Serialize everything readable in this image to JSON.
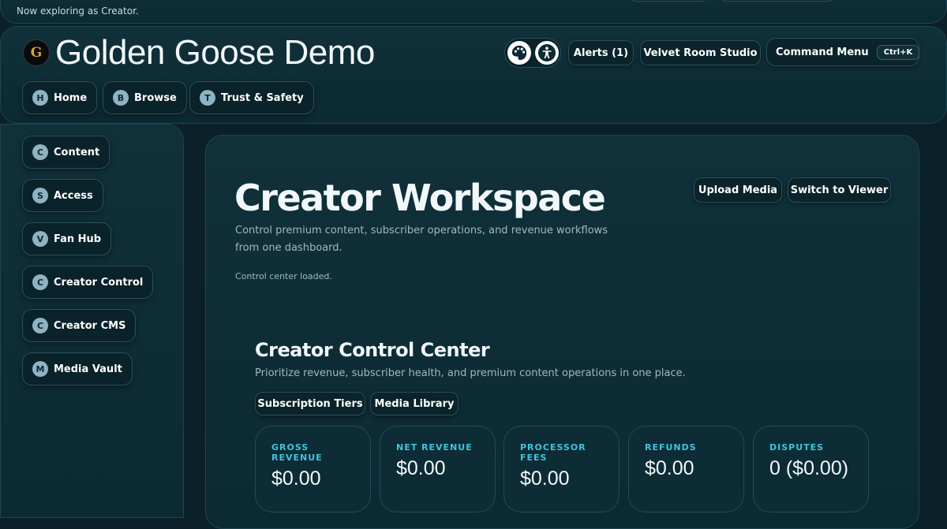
{
  "top_banner": {
    "status": "Now exploring as Creator."
  },
  "header": {
    "title": "Golden Goose Demo",
    "logo_letter": "G",
    "theme_icon": "palette-icon",
    "accessibility_icon": "accessibility-icon",
    "alerts_label": "Alerts (1)",
    "studio_label": "Velvet Room Studio",
    "command_menu_label": "Command Menu",
    "command_shortcut": "Ctrl+K"
  },
  "top_nav": [
    {
      "badge": "H",
      "label": "Home"
    },
    {
      "badge": "B",
      "label": "Browse"
    },
    {
      "badge": "T",
      "label": "Trust & Safety"
    }
  ],
  "sidebar": {
    "items": [
      {
        "badge": "C",
        "label": "Content"
      },
      {
        "badge": "S",
        "label": "Access"
      },
      {
        "badge": "V",
        "label": "Fan Hub"
      },
      {
        "badge": "C",
        "label": "Creator Control"
      },
      {
        "badge": "C",
        "label": "Creator CMS"
      },
      {
        "badge": "M",
        "label": "Media Vault"
      }
    ]
  },
  "main": {
    "title": "Creator Workspace",
    "description": "Control premium content, subscriber operations, and revenue workflows from one dashboard.",
    "status": "Control center loaded.",
    "upload_label": "Upload Media",
    "switch_label": "Switch to Viewer"
  },
  "control_center": {
    "title": "Creator Control Center",
    "subtitle": "Prioritize revenue, subscriber health, and premium content operations in one place.",
    "tabs": [
      "Subscription Tiers",
      "Media Library"
    ],
    "metrics": [
      {
        "label": "GROSS REVENUE",
        "value": "$0.00"
      },
      {
        "label": "NET REVENUE",
        "value": "$0.00"
      },
      {
        "label": "PROCESSOR FEES",
        "value": "$0.00"
      },
      {
        "label": "REFUNDS",
        "value": "$0.00"
      },
      {
        "label": "DISPUTES",
        "value": "0 ($0.00)"
      }
    ]
  },
  "colors": {
    "accent": "#3fc4df",
    "background": "#0b2028",
    "badge": "#8fb3c3",
    "logo_gold": "#d8a33a"
  }
}
